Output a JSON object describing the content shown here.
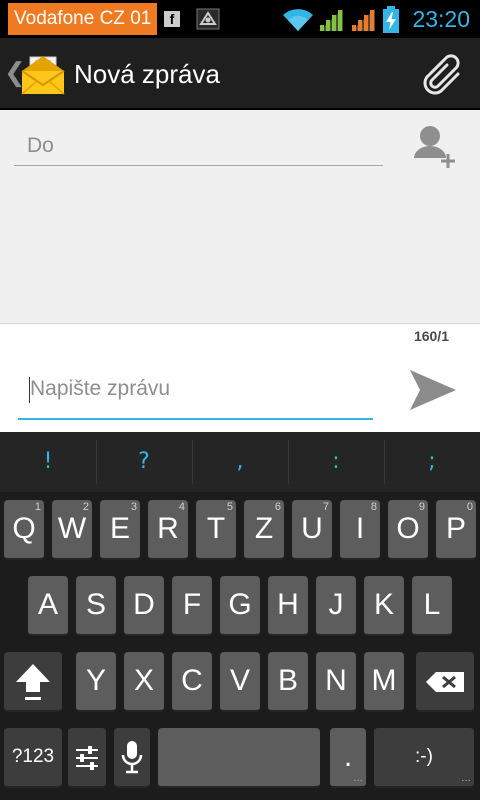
{
  "status_bar": {
    "carrier": "Vodafone CZ 01",
    "fb_icon": "f",
    "time": "23:20",
    "icons": [
      "facebook-icon",
      "app-notification-icon",
      "wifi-icon",
      "signal-icon",
      "signal-roaming-icon",
      "battery-charging-icon"
    ]
  },
  "action_bar": {
    "title": "Nová zpráva",
    "up_glyph": "❮",
    "icons": [
      "messaging-app-icon",
      "attachment-icon"
    ]
  },
  "recipients": {
    "to_placeholder": "Do",
    "icon": "add-contact-icon"
  },
  "compose": {
    "counter": "160/1",
    "message_placeholder": "Napište zprávu",
    "icon": "send-icon"
  },
  "keyboard": {
    "suggestions": [
      "!",
      "?",
      ",",
      ":",
      ";"
    ],
    "row1": [
      {
        "label": "Q",
        "hint": "1"
      },
      {
        "label": "W",
        "hint": "2"
      },
      {
        "label": "E",
        "hint": "3"
      },
      {
        "label": "R",
        "hint": "4"
      },
      {
        "label": "T",
        "hint": "5"
      },
      {
        "label": "Z",
        "hint": "6"
      },
      {
        "label": "U",
        "hint": "7"
      },
      {
        "label": "I",
        "hint": "8"
      },
      {
        "label": "O",
        "hint": "9"
      },
      {
        "label": "P",
        "hint": "0"
      }
    ],
    "row2": [
      "A",
      "S",
      "D",
      "F",
      "G",
      "H",
      "J",
      "K",
      "L"
    ],
    "row3": [
      "Y",
      "X",
      "C",
      "V",
      "B",
      "N",
      "M"
    ],
    "symbols_key": "?123",
    "period_key": ".",
    "smiley_key": ":-)",
    "icons": [
      "shift-icon",
      "backspace-icon",
      "settings-sliders-icon",
      "microphone-icon"
    ]
  },
  "colors": {
    "accent": "#33b5e5",
    "carrier_bg": "#f07a21",
    "action_bar": "#1f1f1f",
    "key": "#5d5d5d",
    "function_key": "#3d3d3d"
  }
}
